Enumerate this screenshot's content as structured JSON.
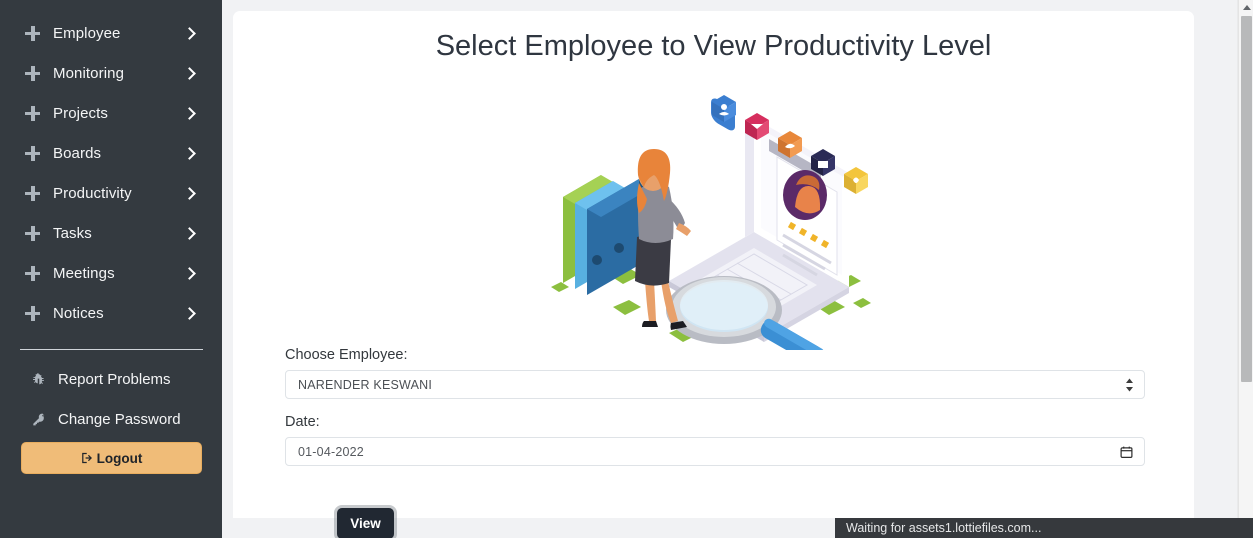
{
  "sidebar": {
    "nav_items": [
      {
        "label": "Employee",
        "icon": "plus-icon",
        "chevron": "chevron-right-icon"
      },
      {
        "label": "Monitoring",
        "icon": "plus-icon",
        "chevron": "chevron-right-icon"
      },
      {
        "label": "Projects",
        "icon": "plus-icon",
        "chevron": "chevron-right-icon"
      },
      {
        "label": "Boards",
        "icon": "plus-icon",
        "chevron": "chevron-right-icon"
      },
      {
        "label": "Productivity",
        "icon": "plus-icon",
        "chevron": "chevron-right-icon"
      },
      {
        "label": "Tasks",
        "icon": "plus-icon",
        "chevron": "chevron-right-icon"
      },
      {
        "label": "Meetings",
        "icon": "plus-icon",
        "chevron": "chevron-right-icon"
      },
      {
        "label": "Notices",
        "icon": "plus-icon",
        "chevron": "chevron-right-icon"
      }
    ],
    "utility_items": [
      {
        "label": "Report Problems",
        "icon": "bug-icon"
      },
      {
        "label": "Change Password",
        "icon": "key-icon"
      }
    ],
    "logout": {
      "label": "Logout",
      "icon": "sign-out-icon"
    },
    "colors": {
      "background": "#343a40",
      "text": "#f4f5f6",
      "icon": "#adb5bd",
      "logout_background": "#f0bc78",
      "logout_text": "#20242a"
    }
  },
  "main": {
    "title": "Select Employee to View Productivity Level",
    "illustration": {
      "name": "employee-productivity-illustration",
      "description": "Isometric illustration of a woman viewing an employee profile on a laptop with a magnifying glass, binders and app icons"
    },
    "form": {
      "employee_field": {
        "label": "Choose Employee:",
        "value": "NARENDER KESWANI",
        "control": "select"
      },
      "date_field": {
        "label": "Date:",
        "value": "01-04-2022",
        "control": "date"
      },
      "submit_button": {
        "label": "View"
      }
    }
  },
  "status_bar": {
    "text": "Waiting for assets1.lottiefiles.com..."
  },
  "colors": {
    "page_background": "#f1f2f4",
    "card_background": "#ffffff",
    "title_text": "#2f3640",
    "button_dark": "#212832",
    "status_background": "#36393d"
  }
}
